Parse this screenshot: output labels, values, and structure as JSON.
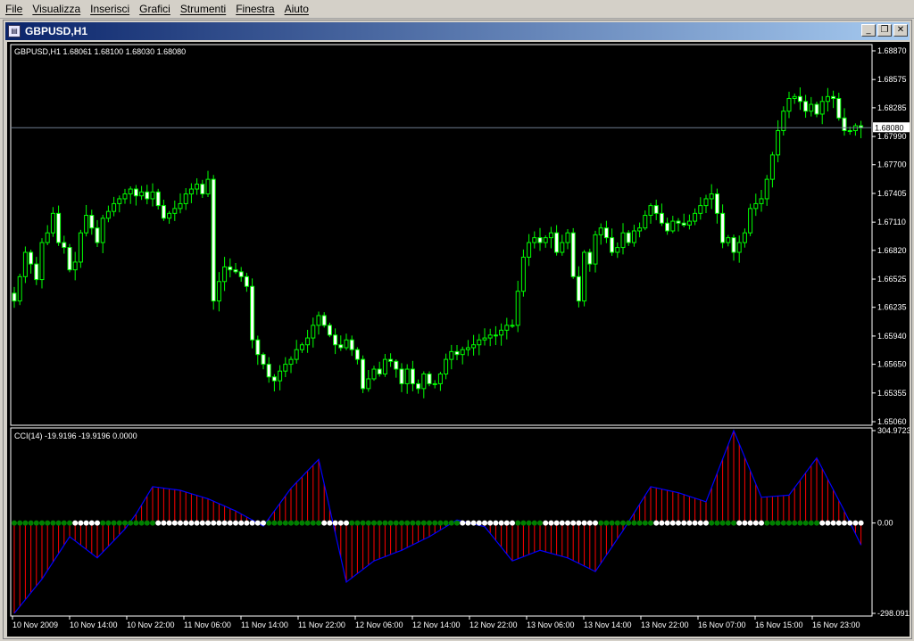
{
  "menu": [
    "File",
    "Visualizza",
    "Inserisci",
    "Grafici",
    "Strumenti",
    "Finestra",
    "Aiuto"
  ],
  "window": {
    "title": "GBPUSD,H1",
    "minimize_glyph": "_",
    "restore_glyph": "❐",
    "close_glyph": "✕"
  },
  "main_chart": {
    "info": "GBPUSD,H1  1.68061 1.68100 1.68030 1.68080",
    "price_levels": [
      "1.68870",
      "1.68575",
      "1.68285",
      "1.67990",
      "1.67700",
      "1.67405",
      "1.67110",
      "1.66820",
      "1.66525",
      "1.66235",
      "1.65940",
      "1.65650",
      "1.65355",
      "1.65060"
    ],
    "current_price": "1.68080",
    "current_price_value": 1.6808,
    "bull_color": "#00ff00",
    "bear_color": "#ffffff"
  },
  "indicator": {
    "info": "CCI(14) -19.9196 -19.9196 0.0000",
    "levels": [
      "304.9723",
      "0.00",
      "-298.0911"
    ],
    "line_color": "#0000ff",
    "bar_color": "#ff0000",
    "dot_up_color": "#008000",
    "dot_down_color": "#ffffff"
  },
  "time_labels": [
    "10 Nov 2009",
    "10 Nov 14:00",
    "10 Nov 22:00",
    "11 Nov 06:00",
    "11 Nov 14:00",
    "11 Nov 22:00",
    "12 Nov 06:00",
    "12 Nov 14:00",
    "12 Nov 22:00",
    "13 Nov 06:00",
    "13 Nov 14:00",
    "13 Nov 22:00",
    "16 Nov 07:00",
    "16 Nov 15:00",
    "16 Nov 23:00"
  ],
  "chart_data": {
    "type": "candlestick",
    "title": "GBPUSD,H1",
    "ylim": [
      1.6506,
      1.6887
    ],
    "close": [
      1.663,
      1.6655,
      1.668,
      1.6668,
      1.6652,
      1.669,
      1.67,
      1.672,
      1.669,
      1.6685,
      1.6662,
      1.667,
      1.67,
      1.6718,
      1.6705,
      1.669,
      1.6715,
      1.6722,
      1.673,
      1.6735,
      1.674,
      1.6745,
      1.6738,
      1.6742,
      1.6735,
      1.6742,
      1.6728,
      1.6715,
      1.672,
      1.6725,
      1.673,
      1.674,
      1.6745,
      1.675,
      1.674,
      1.6755,
      1.663,
      1.665,
      1.6665,
      1.6662,
      1.666,
      1.6655,
      1.6645,
      1.659,
      1.6575,
      1.6565,
      1.6552,
      1.6548,
      1.6558,
      1.6565,
      1.657,
      1.658,
      1.6585,
      1.6592,
      1.6605,
      1.6615,
      1.6605,
      1.6595,
      1.6585,
      1.6582,
      1.659,
      1.658,
      1.657,
      1.654,
      1.655,
      1.656,
      1.6555,
      1.657,
      1.6568,
      1.656,
      1.6545,
      1.656,
      1.6545,
      1.654,
      1.6555,
      1.6545,
      1.6545,
      1.6555,
      1.657,
      1.6578,
      1.6575,
      1.658,
      1.6582,
      1.6585,
      1.659,
      1.6592,
      1.6595,
      1.6595,
      1.66,
      1.6605,
      1.6605,
      1.664,
      1.6675,
      1.669,
      1.6695,
      1.669,
      1.6695,
      1.67,
      1.668,
      1.669,
      1.67,
      1.6655,
      1.663,
      1.668,
      1.6668,
      1.6698,
      1.6705,
      1.6695,
      1.668,
      1.6685,
      1.67,
      1.669,
      1.6702,
      1.6705,
      1.6718,
      1.6728,
      1.672,
      1.671,
      1.6702,
      1.6712,
      1.671,
      1.6708,
      1.6712,
      1.672,
      1.6728,
      1.6735,
      1.674,
      1.672,
      1.669,
      1.6695,
      1.668,
      1.669,
      1.67,
      1.6725,
      1.673,
      1.6735,
      1.6755,
      1.678,
      1.6805,
      1.6825,
      1.6838,
      1.684,
      1.6835,
      1.6825,
      1.6832,
      1.6822,
      1.6835,
      1.684,
      1.6838,
      1.6818,
      1.6805,
      1.6805,
      1.681,
      1.6808
    ],
    "cci_x": [
      0,
      5,
      10,
      15,
      20,
      22,
      25,
      30,
      35,
      40,
      45,
      50,
      55,
      60,
      65,
      70,
      75,
      80,
      85,
      90,
      95,
      100,
      105,
      110,
      115,
      120,
      125,
      130,
      135,
      140,
      145,
      150,
      155
    ],
    "cci_y": [
      -298,
      -185,
      -45,
      -115,
      -20,
      30,
      120,
      108,
      80,
      40,
      -10,
      115,
      210,
      -195,
      -125,
      -90,
      -45,
      10,
      -12,
      -125,
      -90,
      -115,
      -160,
      -25,
      120,
      100,
      70,
      305,
      85,
      92,
      215,
      40,
      -148,
      130,
      145,
      65,
      -15,
      -20
    ],
    "cci_levels": [
      304.9723,
      0.0,
      -298.0911
    ]
  }
}
